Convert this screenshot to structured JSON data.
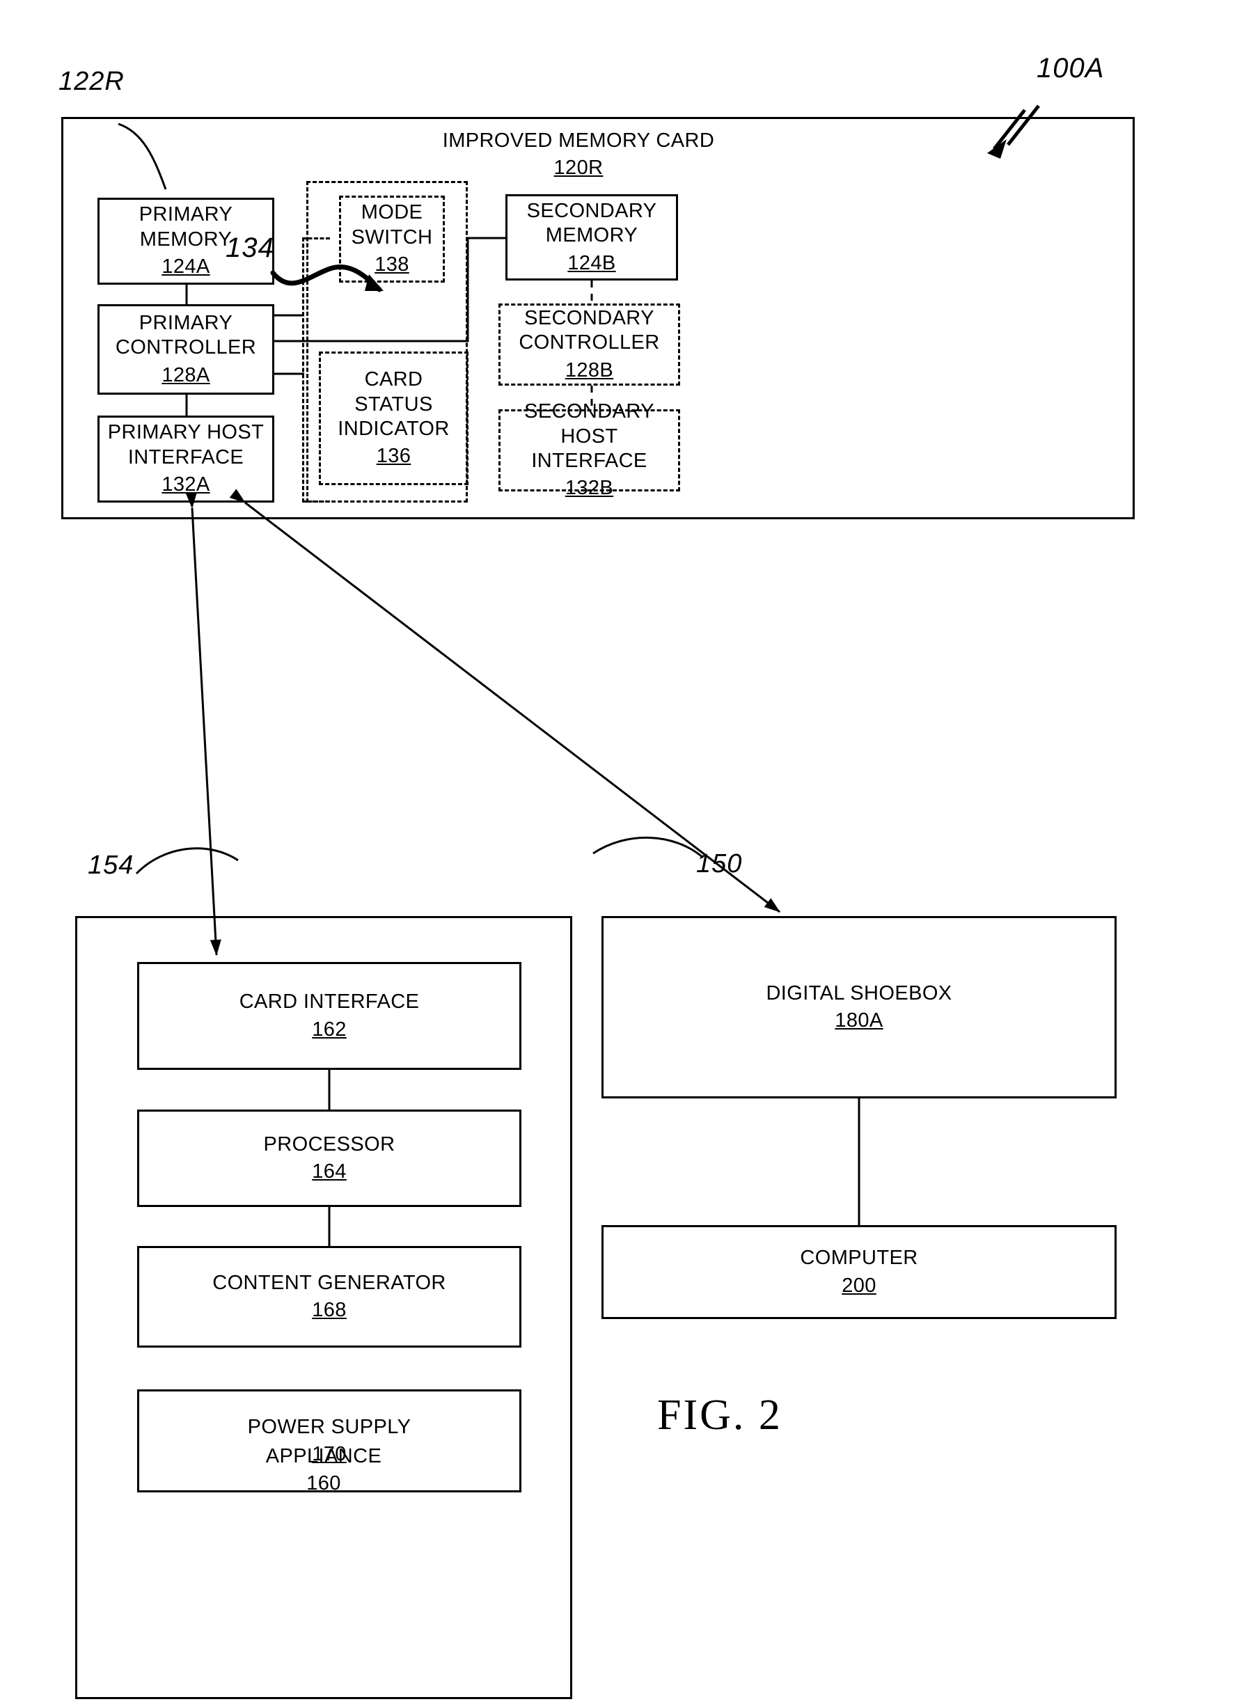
{
  "figure": {
    "label": "FIG. 2",
    "system_ref": "100A"
  },
  "memory_card": {
    "title": "IMPROVED MEMORY CARD",
    "ref": "120R",
    "housing_ref": "122R",
    "optional_region_ref": "134",
    "blocks": {
      "primary_memory": {
        "title": "PRIMARY\nMEMORY",
        "ref": "124A",
        "style": "solid"
      },
      "primary_controller": {
        "title": "PRIMARY\nCONTROLLER",
        "ref": "128A",
        "style": "solid"
      },
      "primary_host_interface": {
        "title": "PRIMARY HOST\nINTERFACE",
        "ref": "132A",
        "style": "solid"
      },
      "mode_switch": {
        "title": "MODE\nSWITCH",
        "ref": "138",
        "style": "dashed"
      },
      "card_status_indicator": {
        "title": "CARD\nSTATUS\nINDICATOR",
        "ref": "136",
        "style": "dashed"
      },
      "secondary_memory": {
        "title": "SECONDARY\nMEMORY",
        "ref": "124B",
        "style": "solid"
      },
      "secondary_controller": {
        "title": "SECONDARY\nCONTROLLER",
        "ref": "128B",
        "style": "dashed"
      },
      "secondary_host_interface": {
        "title": "SECONDARY\nHOST INTERFACE",
        "ref": "132B",
        "style": "dashed"
      }
    }
  },
  "appliance": {
    "title": "APPLIANCE",
    "ref": "160",
    "link_ref": "154",
    "blocks": {
      "card_interface": {
        "title": "CARD INTERFACE",
        "ref": "162"
      },
      "processor": {
        "title": "PROCESSOR",
        "ref": "164"
      },
      "content_generator": {
        "title": "CONTENT GENERATOR",
        "ref": "168"
      },
      "power_supply": {
        "title": "POWER SUPPLY",
        "ref": "170"
      }
    }
  },
  "host_side": {
    "link_ref": "150",
    "blocks": {
      "digital_shoebox": {
        "title": "DIGITAL SHOEBOX",
        "ref": "180A"
      },
      "computer": {
        "title": "COMPUTER",
        "ref": "200"
      }
    }
  },
  "colors": {
    "ink": "#000000",
    "paper": "#ffffff"
  }
}
